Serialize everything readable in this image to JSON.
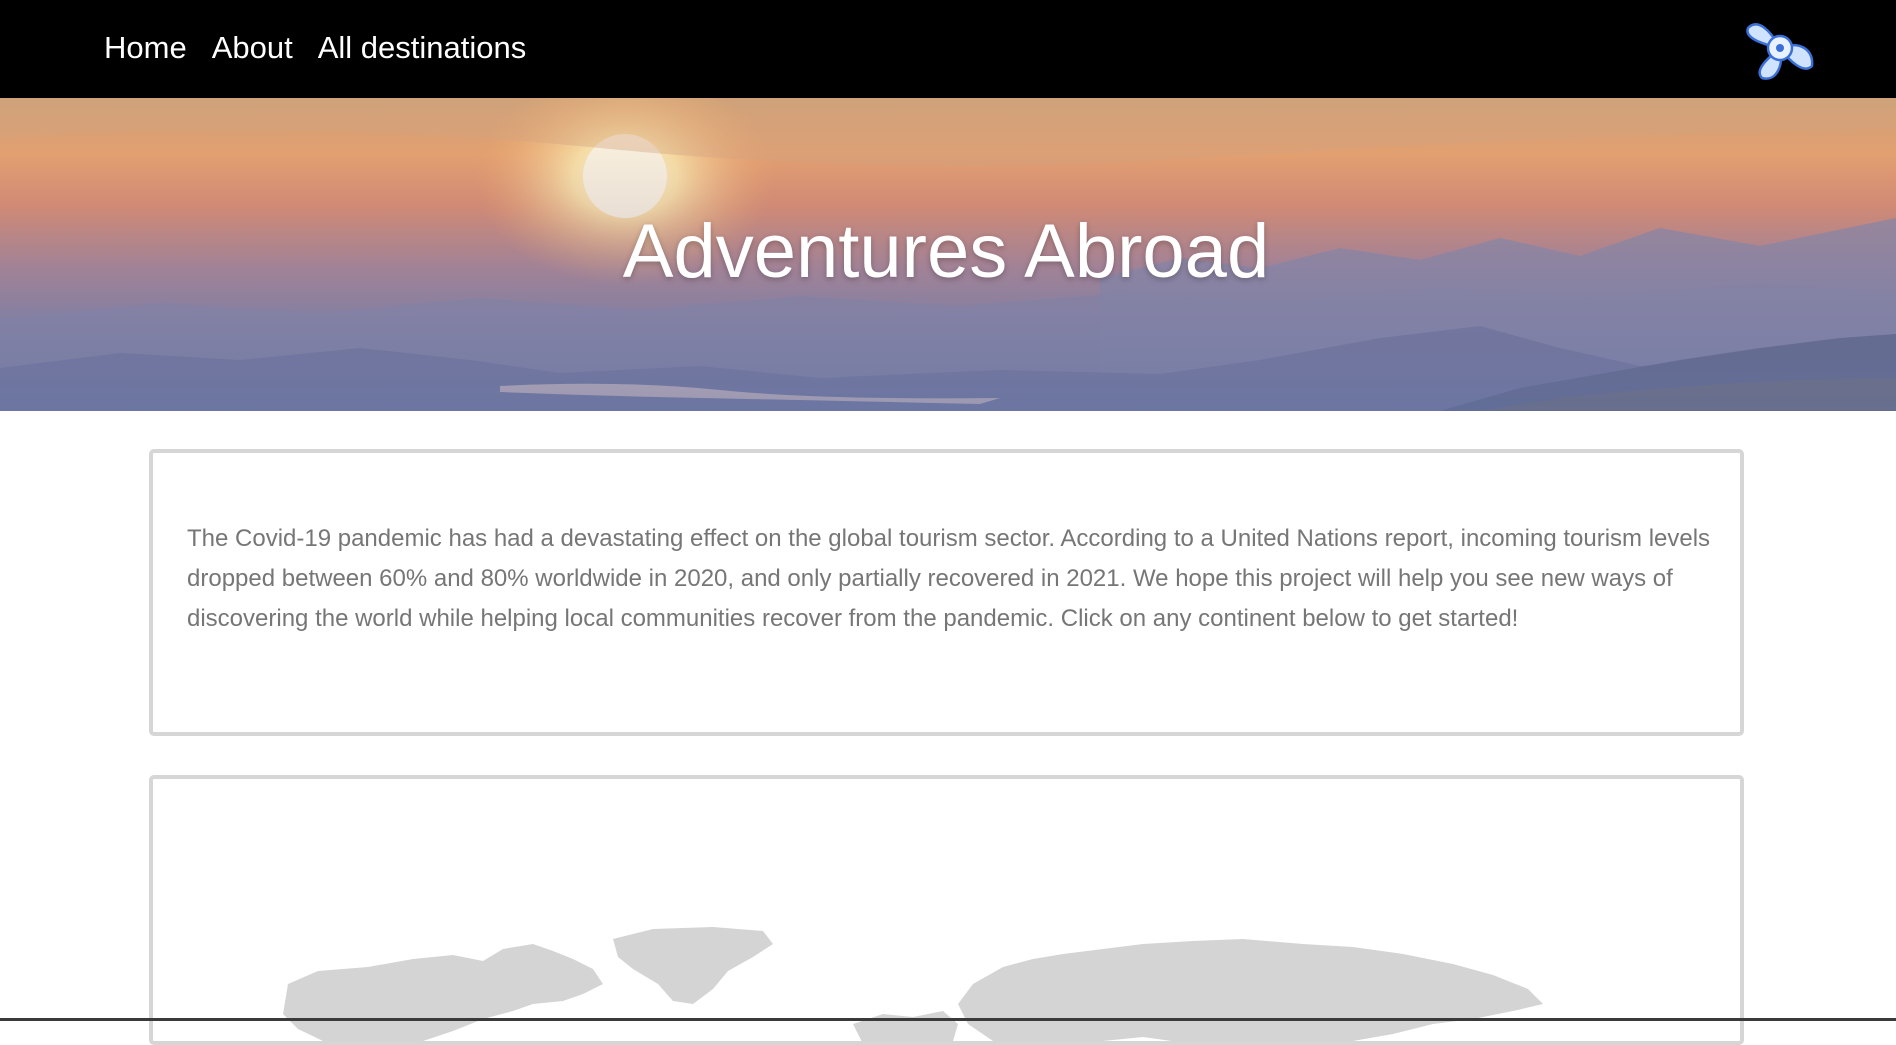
{
  "nav": {
    "links": [
      "Home",
      "About",
      "All destinations"
    ],
    "logo_icon": "propeller-logo-icon"
  },
  "hero": {
    "title": "Adventures Abroad"
  },
  "intro": {
    "text": "The Covid-19 pandemic has had a devastating effect on the global tourism sector. According to a United Nations report, incoming tourism levels dropped between 60% and 80% worldwide in 2020, and only partially recovered in 2021. We hope this project will help you see new ways of discovering the world while helping local communities recover from the pandemic. Click on any continent below to get started!"
  },
  "colors": {
    "navbar": "#000000",
    "card_border": "#d6d6d6",
    "body_text": "#767676",
    "map_land": "#d4d4d4"
  }
}
